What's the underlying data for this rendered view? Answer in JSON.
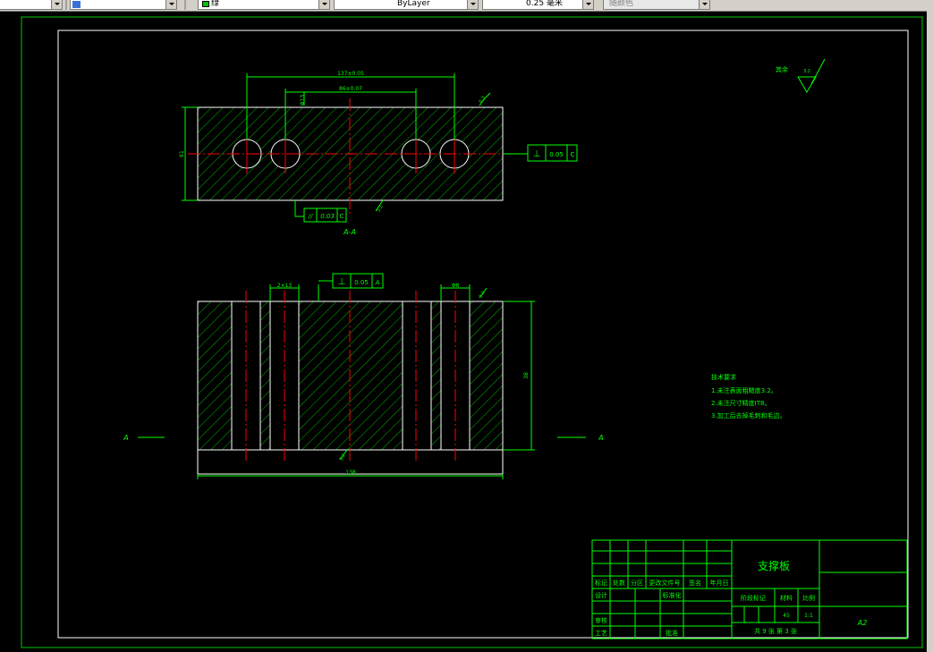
{
  "toolbar": {
    "combo_1": "",
    "layer_combo": "",
    "color_combo": "绿",
    "linetype_combo": "ByLayer",
    "lineweight_combo": "0.25 毫米",
    "plotstyle_combo": "随颜色"
  },
  "colors": {
    "background": "#000000",
    "outline": "#ffffff",
    "hatch": "#00b400",
    "centerline": "#ff0000",
    "dimension": "#00ff00"
  },
  "top_view": {
    "dim_overall": "137±0.05",
    "dim_holes": "86±0.07",
    "dim_height": "61",
    "dim_hole_dia": "Φ13",
    "roughness": "6.3",
    "roughness_bottom": "3.2",
    "section_label": "A-A",
    "tolerance_right": {
      "symbol": "⊥",
      "value": "0.05",
      "datum": "C"
    },
    "tolerance_bottom": {
      "symbol": "//",
      "value": "0.03",
      "datum": "C"
    }
  },
  "front_view": {
    "dim_slot_left": "2×13",
    "dim_slot_right": "Φ8",
    "dim_height": "38",
    "dim_width": "138",
    "roughness_top": "3.2",
    "roughness_bottom": "3.2",
    "section_marker_left": "A",
    "section_marker_right": "A",
    "tolerance_top": {
      "symbol": "⊥",
      "value": "0.05",
      "datum": "A"
    }
  },
  "surface_note": {
    "label": "其余",
    "value": "3.2"
  },
  "tech_requirements": {
    "title": "技术要求",
    "items": [
      "1.未注表面粗糙度3.2。",
      "2.未注尺寸精度IT8。",
      "3.加工后去掉毛刺和毛边。"
    ]
  },
  "title_block": {
    "part_name": "支撑板",
    "header_cells": [
      "标记",
      "处数",
      "分区",
      "更改文件号",
      "签名",
      "年月日"
    ],
    "design": "设计",
    "standardize": "标准化",
    "review": "审核",
    "process": "工艺",
    "approve": "批准",
    "stage_mark": "阶段标记",
    "weight": "材料",
    "scale": "比例",
    "material_value": "45",
    "scale_value": "1:1",
    "sheet_info": "共 9 张  第 3 张",
    "sheet_size": "A2"
  }
}
